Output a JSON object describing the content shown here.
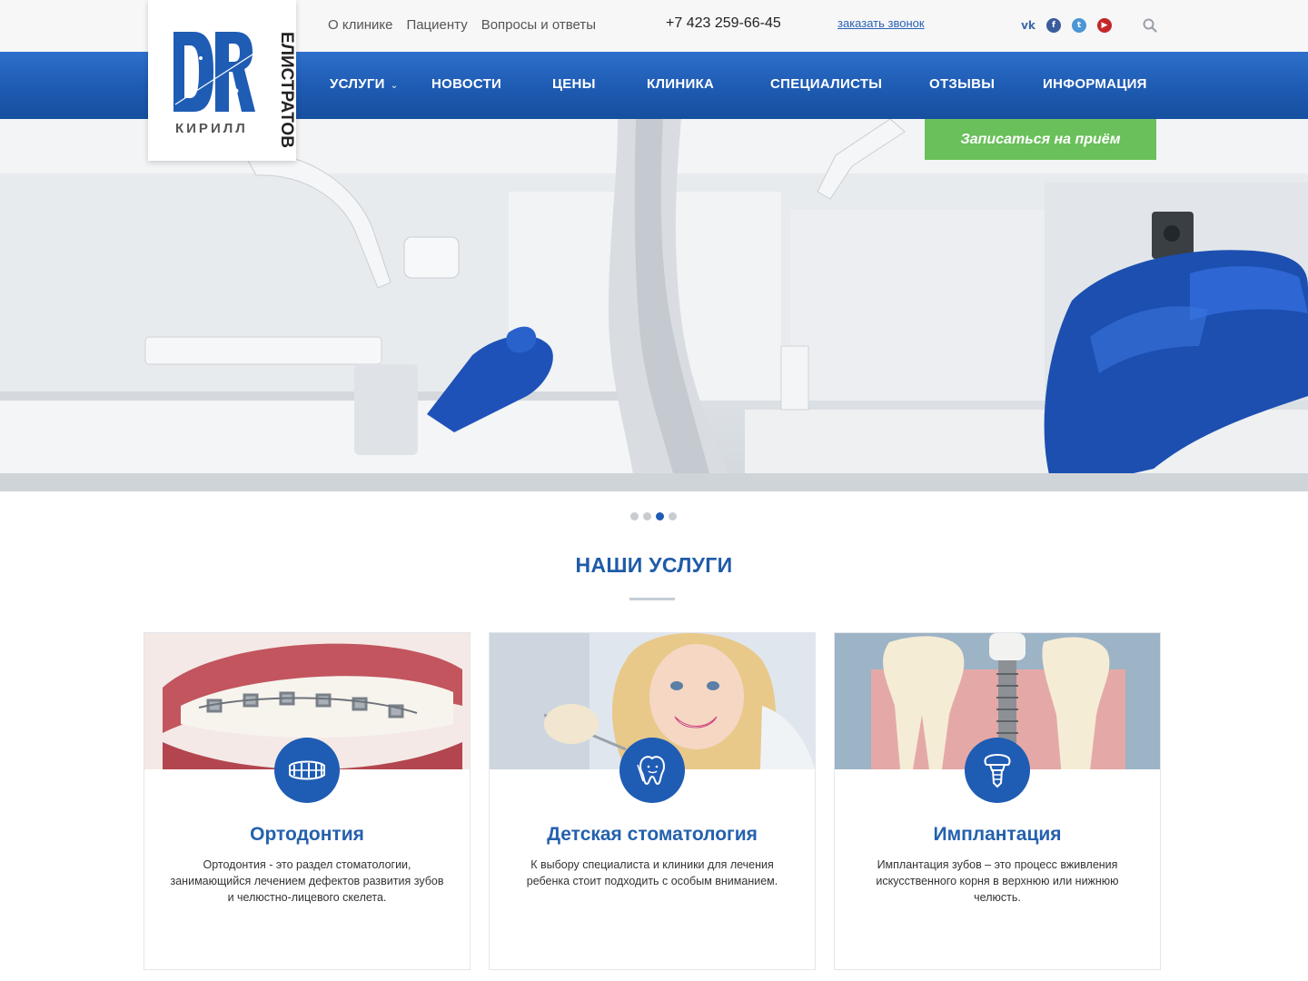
{
  "topbar": {
    "links": [
      "О клинике",
      "Пациенту",
      "Вопросы и ответы"
    ],
    "phone": "+7 423 259-66-45",
    "callback": "заказать звонок",
    "socials": [
      {
        "name": "vk-icon",
        "glyph": "vk"
      },
      {
        "name": "facebook-icon",
        "glyph": "f"
      },
      {
        "name": "twitter-icon",
        "glyph": "t"
      },
      {
        "name": "youtube-icon",
        "glyph": "▶"
      }
    ]
  },
  "logo": {
    "mark": "DR",
    "first_name": "КИРИЛЛ",
    "last_name": "ЕЛИСТРАТОВ"
  },
  "nav": {
    "items": [
      "УСЛУГИ",
      "НОВОСТИ",
      "ЦЕНЫ",
      "КЛИНИКА",
      "СПЕЦИАЛИСТЫ",
      "ОТЗЫВЫ",
      "ИНФОРМАЦИЯ"
    ]
  },
  "hero": {
    "cta": "Записаться на приём",
    "slides_total": 4,
    "active_slide": 3
  },
  "services": {
    "title": "НАШИ УСЛУГИ",
    "cards": [
      {
        "title": "Ортодонтия",
        "text": "Ортодонтия - это раздел стоматологии, занимающийся лечением дефектов развития зубов и челюстно-лицевого скелета.",
        "icon": "braces-icon"
      },
      {
        "title": "Детская стоматология",
        "text": "К выбору специалиста и клиники для лечения ребенка стоит подходить с особым вниманием.",
        "icon": "child-tooth-icon"
      },
      {
        "title": "Имплантация",
        "text": "Имплантация зубов – это процесс вживления искусственного корня в верхнюю или нижнюю челюсть.",
        "icon": "implant-icon"
      }
    ]
  },
  "colors": {
    "brand_blue": "#1f5cb4",
    "cta_green": "#6ac05a",
    "title_blue": "#1f5ba8"
  }
}
